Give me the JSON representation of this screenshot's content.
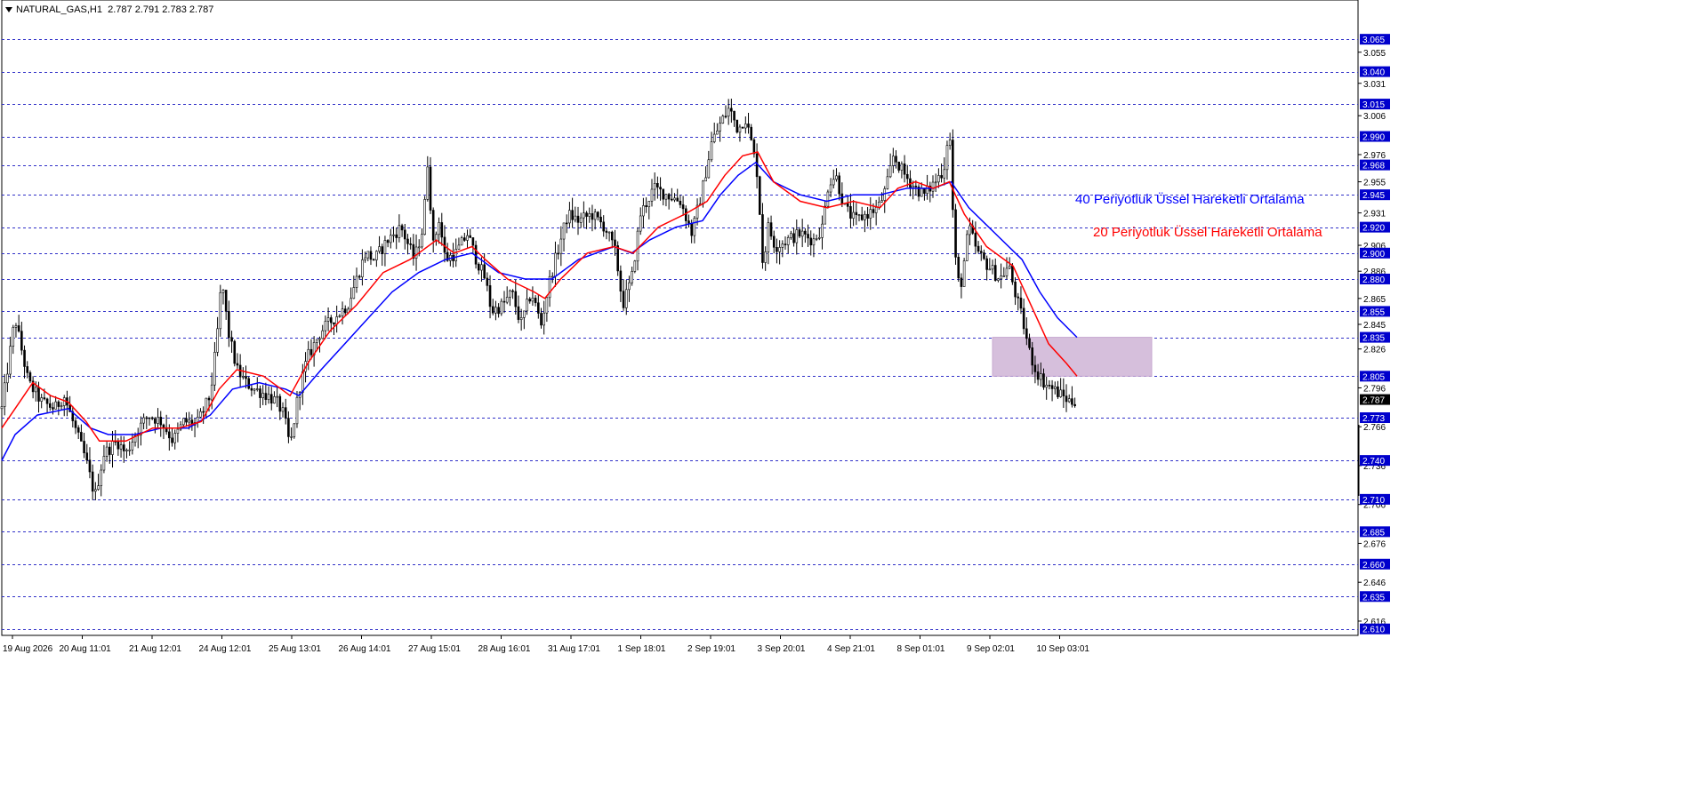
{
  "header": {
    "symbol": "NATURAL_GAS,H1",
    "ohlc": "2.787 2.791 2.783 2.787"
  },
  "colors": {
    "grid": "#3030c8",
    "accent_box": "#d6bfdc",
    "ema20": "#ff0000",
    "ema40": "#0000ff",
    "price_box_bg": "#0000cc",
    "current_box_bg": "#000000",
    "candle": "#000000"
  },
  "legend": {
    "ema40_label": "40 Periyotluk Üssel Hareketli Ortalama",
    "ema20_label": "20 Periyotluk Üssel Hareketli Ortalama"
  },
  "chart_data": {
    "type": "candlestick",
    "ylim": [
      2.605,
      3.085
    ],
    "highlighted_levels": [
      "3.065",
      "3.040",
      "3.015",
      "2.990",
      "2.968",
      "2.945",
      "2.920",
      "2.900",
      "2.880",
      "2.855",
      "2.835",
      "2.805",
      "2.773",
      "2.740",
      "2.710",
      "2.685",
      "2.660",
      "2.635",
      "2.610"
    ],
    "plain_ticks": [
      "3.055",
      "3.031",
      "3.006",
      "2.976",
      "2.955",
      "2.931",
      "2.906",
      "2.886",
      "2.865",
      "2.845",
      "2.826",
      "2.796",
      "2.766",
      "2.736",
      "2.706",
      "2.676",
      "2.646",
      "2.616"
    ],
    "current_price": "2.787",
    "x_labels": [
      "19 Aug 2026",
      "20 Aug 11:01",
      "21 Aug 12:01",
      "24 Aug 12:01",
      "25 Aug 13:01",
      "26 Aug 14:01",
      "27 Aug 15:01",
      "28 Aug 16:01",
      "31 Aug 17:01",
      "1 Sep 18:01",
      "2 Sep 19:01",
      "3 Sep 20:01",
      "4 Sep 21:01",
      "8 Sep 01:01",
      "9 Sep 02:01",
      "10 Sep 03:01"
    ],
    "zone": {
      "x_from": "9 Sep 02:01",
      "y_low": 2.805,
      "y_high": 2.835
    },
    "price_path": [
      [
        0,
        2.78
      ],
      [
        15,
        2.85
      ],
      [
        30,
        2.8
      ],
      [
        45,
        2.785
      ],
      [
        60,
        2.78
      ],
      [
        70,
        2.79
      ],
      [
        80,
        2.77
      ],
      [
        95,
        2.74
      ],
      [
        105,
        2.712
      ],
      [
        115,
        2.745
      ],
      [
        130,
        2.755
      ],
      [
        140,
        2.745
      ],
      [
        150,
        2.76
      ],
      [
        165,
        2.775
      ],
      [
        180,
        2.77
      ],
      [
        193,
        2.755
      ],
      [
        205,
        2.77
      ],
      [
        220,
        2.768
      ],
      [
        235,
        2.79
      ],
      [
        242,
        2.83
      ],
      [
        248,
        2.88
      ],
      [
        255,
        2.84
      ],
      [
        265,
        2.81
      ],
      [
        275,
        2.8
      ],
      [
        285,
        2.795
      ],
      [
        300,
        2.79
      ],
      [
        310,
        2.785
      ],
      [
        318,
        2.775
      ],
      [
        325,
        2.75
      ],
      [
        335,
        2.795
      ],
      [
        345,
        2.82
      ],
      [
        360,
        2.84
      ],
      [
        375,
        2.85
      ],
      [
        390,
        2.86
      ],
      [
        400,
        2.88
      ],
      [
        410,
        2.9
      ],
      [
        420,
        2.895
      ],
      [
        435,
        2.91
      ],
      [
        450,
        2.92
      ],
      [
        465,
        2.895
      ],
      [
        475,
        2.92
      ],
      [
        480,
        2.97
      ],
      [
        487,
        2.9
      ],
      [
        492,
        2.93
      ],
      [
        500,
        2.895
      ],
      [
        512,
        2.9
      ],
      [
        525,
        2.915
      ],
      [
        535,
        2.895
      ],
      [
        545,
        2.88
      ],
      [
        552,
        2.855
      ],
      [
        565,
        2.86
      ],
      [
        575,
        2.87
      ],
      [
        585,
        2.845
      ],
      [
        597,
        2.87
      ],
      [
        608,
        2.845
      ],
      [
        618,
        2.88
      ],
      [
        628,
        2.905
      ],
      [
        638,
        2.93
      ],
      [
        650,
        2.925
      ],
      [
        665,
        2.93
      ],
      [
        680,
        2.92
      ],
      [
        692,
        2.9
      ],
      [
        700,
        2.86
      ],
      [
        710,
        2.88
      ],
      [
        720,
        2.93
      ],
      [
        735,
        2.95
      ],
      [
        750,
        2.945
      ],
      [
        765,
        2.94
      ],
      [
        778,
        2.915
      ],
      [
        790,
        2.95
      ],
      [
        800,
        2.985
      ],
      [
        810,
        3.0
      ],
      [
        820,
        3.012
      ],
      [
        830,
        2.995
      ],
      [
        838,
        3.005
      ],
      [
        845,
        2.985
      ],
      [
        852,
        2.96
      ],
      [
        858,
        2.89
      ],
      [
        864,
        2.92
      ],
      [
        872,
        2.905
      ],
      [
        885,
        2.91
      ],
      [
        900,
        2.915
      ],
      [
        915,
        2.91
      ],
      [
        925,
        2.92
      ],
      [
        932,
        2.955
      ],
      [
        940,
        2.96
      ],
      [
        950,
        2.935
      ],
      [
        962,
        2.925
      ],
      [
        975,
        2.93
      ],
      [
        988,
        2.935
      ],
      [
        997,
        2.95
      ],
      [
        1005,
        2.975
      ],
      [
        1018,
        2.96
      ],
      [
        1030,
        2.95
      ],
      [
        1040,
        2.945
      ],
      [
        1052,
        2.955
      ],
      [
        1062,
        2.965
      ],
      [
        1068,
        3.0
      ],
      [
        1074,
        2.9
      ],
      [
        1080,
        2.87
      ],
      [
        1090,
        2.92
      ],
      [
        1100,
        2.9
      ],
      [
        1112,
        2.89
      ],
      [
        1125,
        2.88
      ],
      [
        1135,
        2.89
      ],
      [
        1142,
        2.87
      ],
      [
        1150,
        2.85
      ],
      [
        1158,
        2.825
      ],
      [
        1165,
        2.81
      ],
      [
        1175,
        2.8
      ],
      [
        1185,
        2.795
      ],
      [
        1195,
        2.79
      ],
      [
        1205,
        2.785
      ],
      [
        1212,
        2.787
      ]
    ],
    "series": [
      {
        "name": "40 Periyotluk Üssel Hareketli Ortalama",
        "color": "#0000ff",
        "points": [
          [
            0,
            2.74
          ],
          [
            15,
            2.76
          ],
          [
            40,
            2.775
          ],
          [
            75,
            2.78
          ],
          [
            100,
            2.765
          ],
          [
            120,
            2.76
          ],
          [
            150,
            2.76
          ],
          [
            180,
            2.765
          ],
          [
            210,
            2.765
          ],
          [
            235,
            2.775
          ],
          [
            260,
            2.795
          ],
          [
            290,
            2.8
          ],
          [
            320,
            2.795
          ],
          [
            335,
            2.79
          ],
          [
            360,
            2.81
          ],
          [
            400,
            2.84
          ],
          [
            440,
            2.87
          ],
          [
            470,
            2.885
          ],
          [
            500,
            2.895
          ],
          [
            530,
            2.9
          ],
          [
            560,
            2.885
          ],
          [
            590,
            2.88
          ],
          [
            620,
            2.88
          ],
          [
            650,
            2.895
          ],
          [
            690,
            2.905
          ],
          [
            710,
            2.9
          ],
          [
            730,
            2.91
          ],
          [
            760,
            2.92
          ],
          [
            790,
            2.925
          ],
          [
            810,
            2.945
          ],
          [
            830,
            2.96
          ],
          [
            850,
            2.97
          ],
          [
            870,
            2.955
          ],
          [
            900,
            2.945
          ],
          [
            930,
            2.94
          ],
          [
            960,
            2.945
          ],
          [
            990,
            2.945
          ],
          [
            1020,
            2.95
          ],
          [
            1050,
            2.95
          ],
          [
            1070,
            2.955
          ],
          [
            1090,
            2.935
          ],
          [
            1120,
            2.915
          ],
          [
            1150,
            2.895
          ],
          [
            1170,
            2.87
          ],
          [
            1190,
            2.85
          ],
          [
            1212,
            2.835
          ]
        ]
      },
      {
        "name": "20 Periyotluk Üssel Hareketli Ortalama",
        "color": "#ff0000",
        "points": [
          [
            0,
            2.765
          ],
          [
            15,
            2.78
          ],
          [
            35,
            2.8
          ],
          [
            55,
            2.79
          ],
          [
            75,
            2.785
          ],
          [
            95,
            2.77
          ],
          [
            110,
            2.755
          ],
          [
            140,
            2.755
          ],
          [
            170,
            2.765
          ],
          [
            200,
            2.765
          ],
          [
            225,
            2.77
          ],
          [
            245,
            2.795
          ],
          [
            265,
            2.81
          ],
          [
            295,
            2.805
          ],
          [
            325,
            2.79
          ],
          [
            345,
            2.815
          ],
          [
            370,
            2.84
          ],
          [
            400,
            2.86
          ],
          [
            430,
            2.885
          ],
          [
            460,
            2.895
          ],
          [
            490,
            2.91
          ],
          [
            510,
            2.9
          ],
          [
            530,
            2.905
          ],
          [
            545,
            2.895
          ],
          [
            570,
            2.88
          ],
          [
            600,
            2.87
          ],
          [
            612,
            2.865
          ],
          [
            630,
            2.88
          ],
          [
            660,
            2.9
          ],
          [
            690,
            2.905
          ],
          [
            712,
            2.9
          ],
          [
            740,
            2.92
          ],
          [
            770,
            2.93
          ],
          [
            795,
            2.94
          ],
          [
            815,
            2.96
          ],
          [
            835,
            2.975
          ],
          [
            852,
            2.978
          ],
          [
            870,
            2.955
          ],
          [
            900,
            2.94
          ],
          [
            930,
            2.935
          ],
          [
            960,
            2.94
          ],
          [
            990,
            2.935
          ],
          [
            1010,
            2.95
          ],
          [
            1030,
            2.955
          ],
          [
            1050,
            2.95
          ],
          [
            1068,
            2.955
          ],
          [
            1085,
            2.93
          ],
          [
            1110,
            2.905
          ],
          [
            1140,
            2.89
          ],
          [
            1160,
            2.86
          ],
          [
            1180,
            2.83
          ],
          [
            1200,
            2.815
          ],
          [
            1212,
            2.805
          ]
        ]
      }
    ]
  }
}
